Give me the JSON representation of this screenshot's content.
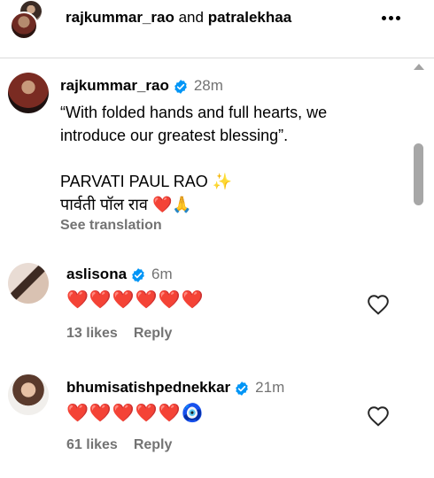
{
  "header": {
    "user1": "rajkummar_rao",
    "and_text": "and",
    "user2": "patralekhaa"
  },
  "post": {
    "username": "rajkummar_rao",
    "time": "28m",
    "caption": "“With folded hands and full hearts, we introduce our greatest blessing”.\n\nPARVATI PAUL RAO ✨\nपार्वती पॉल राव ❤️🙏",
    "see_translation": "See translation"
  },
  "comments": [
    {
      "username": "aslisona",
      "time": "6m",
      "text": "❤️❤️❤️❤️❤️❤️",
      "likes": "13 likes",
      "reply": "Reply"
    },
    {
      "username": "bhumisatishpednekkar",
      "time": "21m",
      "text": "❤️❤️❤️❤️❤️🧿",
      "likes": "61 likes",
      "reply": "Reply"
    }
  ],
  "colors": {
    "verified": "#0095f6",
    "muted": "#737373",
    "heart": "#e0162b"
  }
}
